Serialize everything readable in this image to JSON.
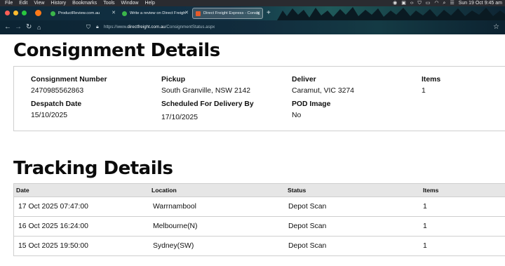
{
  "menubar": {
    "items": [
      "File",
      "Edit",
      "View",
      "History",
      "Bookmarks",
      "Tools",
      "Window",
      "Help"
    ],
    "clock": "Sun 19 Oct  9:45 am"
  },
  "tabs": [
    {
      "title": "ProductReview.com.au",
      "favicon_color": "#3bb54a"
    },
    {
      "title": "Write a review on Direct Freight",
      "favicon_color": "#3bb54a"
    },
    {
      "title": "Direct Freight Express - Consig",
      "favicon_color": "#e55b2a"
    }
  ],
  "navbar": {
    "url_prefix": "https://www.",
    "url_domain": "directfreight.com.au",
    "url_path": "/ConsignmentStatus.aspx"
  },
  "consignment": {
    "title": "Consignment Details",
    "fields": [
      {
        "label": "Consignment Number",
        "value": "2470985562863"
      },
      {
        "label": "Pickup",
        "value": "South Granville, NSW 2142"
      },
      {
        "label": "Deliver",
        "value": "Caramut, VIC 3274"
      },
      {
        "label": "Items",
        "value": "1"
      },
      {
        "label": "Despatch Date",
        "value": "15/10/2025"
      },
      {
        "label": "Scheduled For Delivery By",
        "value": "17/10/2025"
      },
      {
        "label": "POD Image",
        "value": "No"
      }
    ]
  },
  "tracking": {
    "title": "Tracking Details",
    "columns": [
      "Date",
      "Location",
      "Status",
      "Items"
    ],
    "rows": [
      [
        "17 Oct 2025 07:47:00",
        "Warrnambool",
        "Depot Scan",
        "1"
      ],
      [
        "16 Oct 2025 16:24:00",
        "Melbourne(N)",
        "Depot Scan",
        "1"
      ],
      [
        "15 Oct 2025 19:50:00",
        "Sydney(SW)",
        "Depot Scan",
        "1"
      ]
    ]
  }
}
